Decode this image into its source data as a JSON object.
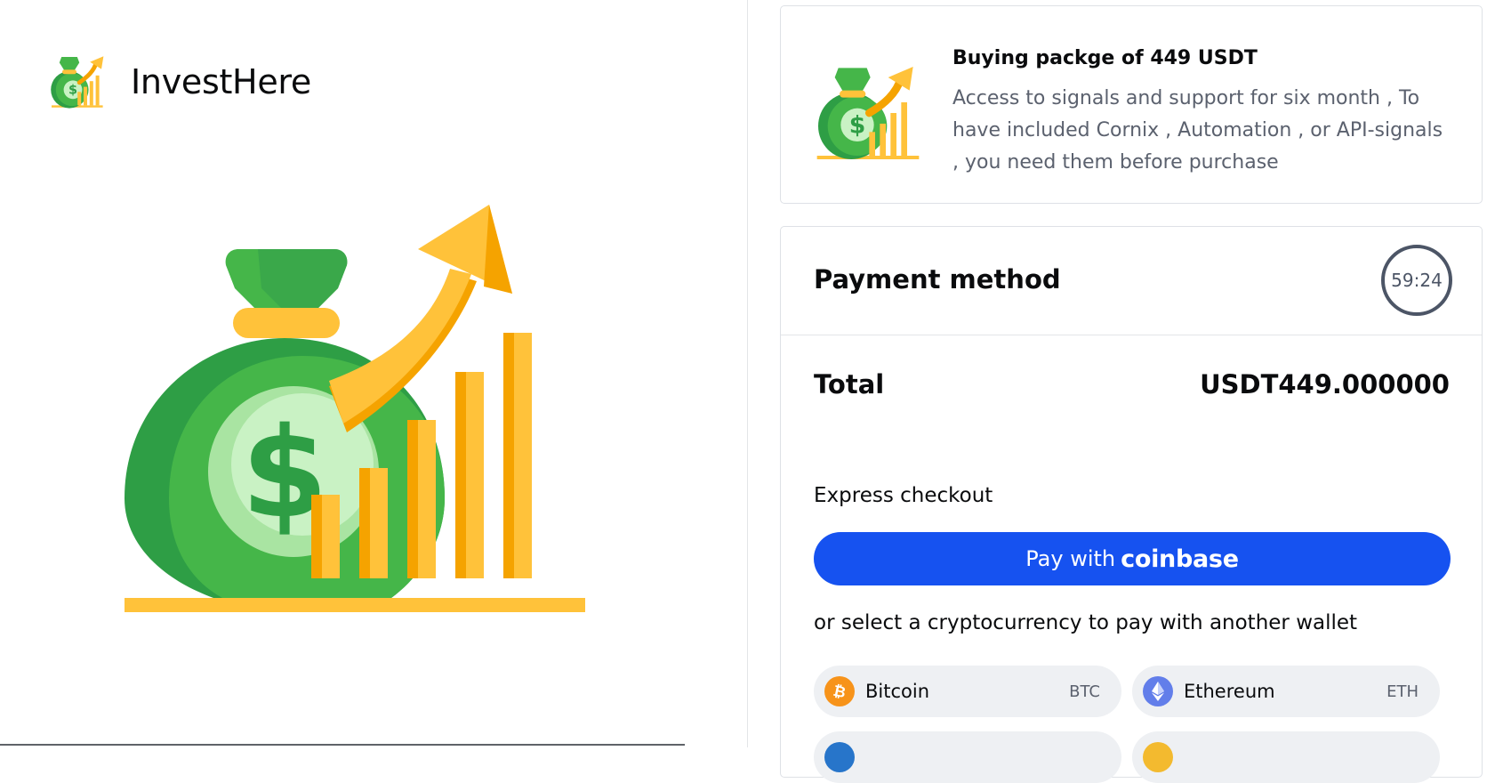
{
  "brand": {
    "name": "InvestHere"
  },
  "product": {
    "title": "Buying packge of 449 USDT",
    "description": "Access to signals and support for six month , To have included Cornix , Automation , or API-signals , you need them before purchase"
  },
  "payment": {
    "title": "Payment method",
    "timer": "59:24",
    "total_label": "Total",
    "total_value": "USDT449.000000",
    "express_label": "Express checkout",
    "pay_button": {
      "prefix": "Pay with",
      "brand": "coinbase"
    },
    "alt_label": "or select a cryptocurrency to pay with another wallet",
    "currencies": [
      {
        "name": "Bitcoin",
        "code": "BTC",
        "color": "#f7931a"
      },
      {
        "name": "Ethereum",
        "code": "ETH",
        "color": "#627eea"
      }
    ]
  },
  "colors": {
    "primary_blue": "#1652f0",
    "chip_bg": "#eef0f3",
    "text_secondary": "#5b616e",
    "logo_green": "#45b649",
    "logo_gold": "#ffc23a"
  },
  "icons": [
    "money-bag-growth-icon",
    "bitcoin-icon",
    "ethereum-icon"
  ]
}
